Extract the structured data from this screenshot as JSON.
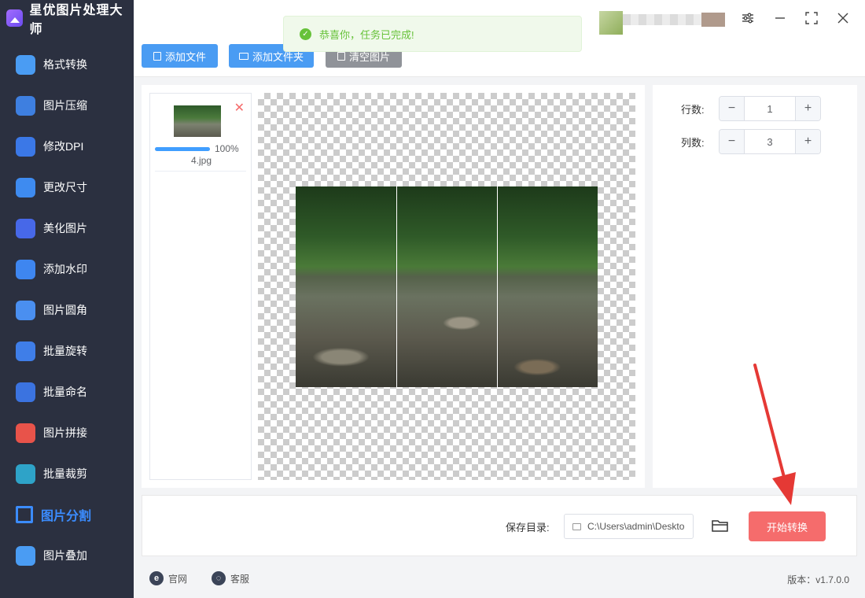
{
  "app": {
    "title": "星优图片处理大师"
  },
  "sidebar": {
    "items": [
      {
        "label": "格式转换",
        "icon": "image-convert-icon",
        "color": "#4a9cf3"
      },
      {
        "label": "图片压缩",
        "icon": "image-compress-icon",
        "color": "#3e7fe0"
      },
      {
        "label": "修改DPI",
        "icon": "dpi-icon",
        "color": "#3b78e7"
      },
      {
        "label": "更改尺寸",
        "icon": "resize-icon",
        "color": "#3e8bf0"
      },
      {
        "label": "美化图片",
        "icon": "beautify-icon",
        "color": "#4768e8"
      },
      {
        "label": "添加水印",
        "icon": "watermark-icon",
        "color": "#3e86f0"
      },
      {
        "label": "图片圆角",
        "icon": "round-corner-icon",
        "color": "#4a8ff0"
      },
      {
        "label": "批量旋转",
        "icon": "rotate-icon",
        "color": "#3f7ee8"
      },
      {
        "label": "批量命名",
        "icon": "rename-icon",
        "color": "#3b73e0"
      },
      {
        "label": "图片拼接",
        "icon": "stitch-icon",
        "color": "#e8534a"
      },
      {
        "label": "批量裁剪",
        "icon": "crop-icon",
        "color": "#2ea3c8"
      },
      {
        "label": "图片分割",
        "icon": "split-icon",
        "color": "#3b8cff"
      },
      {
        "label": "图片叠加",
        "icon": "layers-icon",
        "color": "#4a9cf3"
      }
    ],
    "active_index": 11
  },
  "toast": {
    "message": "恭喜你，任务已完成!"
  },
  "toolbar": {
    "add_file": "添加文件",
    "add_folder": "添加文件夹",
    "clear_images": "清空图片"
  },
  "file_list": {
    "items": [
      {
        "name": "4.jpg",
        "progress_text": "100%",
        "progress": 1.0
      }
    ]
  },
  "settings": {
    "rows_label": "行数:",
    "rows_value": "1",
    "cols_label": "列数:",
    "cols_value": "3"
  },
  "bottom": {
    "save_label": "保存目录:",
    "save_path": "C:\\Users\\admin\\Deskto",
    "start_button": "开始转换"
  },
  "statusbar": {
    "website": "官网",
    "support": "客服",
    "version": "版本：v1.7.0.0"
  },
  "colors": {
    "sidebar_bg": "#2b3040",
    "accent": "#3b8cff",
    "primary_button": "#4a9cf3",
    "start_button": "#f56c6c",
    "success": "#67c23a",
    "annotation_arrow": "#e53935"
  }
}
